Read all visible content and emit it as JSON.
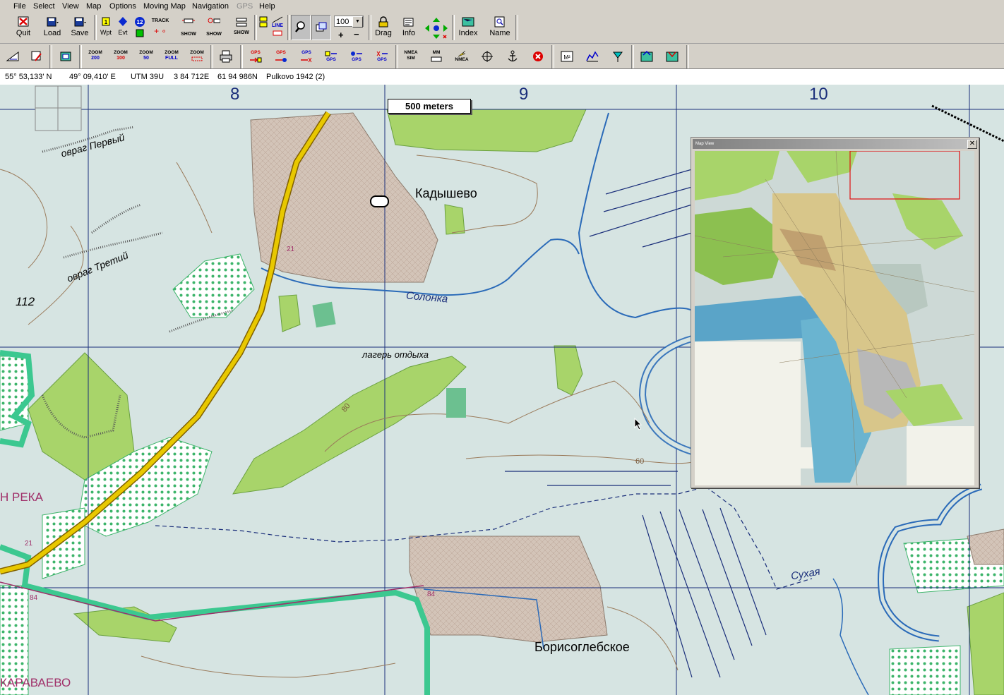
{
  "menu": [
    "File",
    "Select",
    "View",
    "Map",
    "Options",
    "Moving Map",
    "Navigation",
    "GPS",
    "Help"
  ],
  "toolbar1": {
    "quit": "Quit",
    "load": "Load",
    "save": "Save",
    "wpt": "Wpt",
    "evt": "Evt",
    "track": "TRACK",
    "show1": "SHOW",
    "show2": "SHOW",
    "show3": "SHOW",
    "line": "LINE",
    "zoom_value": "100",
    "drag": "Drag",
    "info": "Info",
    "index": "Index",
    "name": "Name",
    "badge_1": "1",
    "badge_12": "12"
  },
  "toolbar2": {
    "zoom200": [
      "ZOOM",
      "200"
    ],
    "zoom100": [
      "ZOOM",
      "100"
    ],
    "zoom50": [
      "ZOOM",
      "50"
    ],
    "zoomfull": [
      "ZOOM",
      "FULL"
    ],
    "zoom": "ZOOM",
    "gps": "GPS",
    "nmea_sim": [
      "NMEA",
      "SIM"
    ],
    "mm": "MM",
    "nmea": "NMEA",
    "m2": "M²"
  },
  "status": {
    "lat": "55° 53,133' N",
    "lon": "49° 09,410' E",
    "utm": "UTM  39U",
    "easting": "3 84 712E",
    "northing": "61 94 986N",
    "datum": "Pulkovo 1942 (2)"
  },
  "map": {
    "grid_labels": [
      "8",
      "9",
      "10"
    ],
    "scale": "500 meters",
    "labels": {
      "kadyshevo": "Кадышево",
      "borisoglebskoe": "Борисоглебское",
      "solonka": "Солонка",
      "sukhaya": "Сухая",
      "lager": "лагерь отдыха",
      "ovrag1": "овраг Первый",
      "ovrag3": "овраг Третий",
      "elev112": "112",
      "reka": "Н РЕКА",
      "karavaevo": "КАРАВАЕВО",
      "c80": "80",
      "c60": "60",
      "r21a": "21",
      "r21b": "21",
      "p84a": "84",
      "p84b": "84"
    }
  },
  "mapview": {
    "title": "Map View",
    "close": "✕"
  },
  "colors": {
    "map_background": "#d6e4e2",
    "forest": "#a8d46a",
    "road": "#e8c800",
    "water": "#2a6ab8",
    "pipeline": "#3cc890",
    "settlement": "#c9b6a6"
  }
}
